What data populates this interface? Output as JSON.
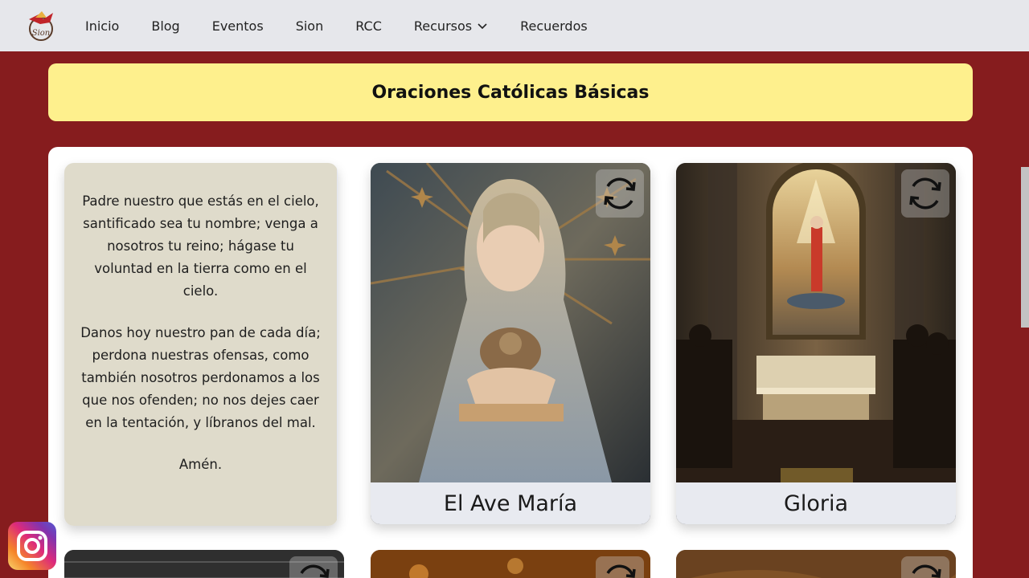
{
  "nav": {
    "items": [
      {
        "label": "Inicio"
      },
      {
        "label": "Blog"
      },
      {
        "label": "Eventos"
      },
      {
        "label": "Sion"
      },
      {
        "label": "RCC"
      },
      {
        "label": "Recursos",
        "icon": "chevron-down-icon"
      },
      {
        "label": "Recuerdos"
      }
    ],
    "logo_text": "Sion"
  },
  "banner": {
    "title": "Oraciones Católicas Básicas"
  },
  "cards": {
    "prayer": {
      "paragraph1": "Padre nuestro que estás en el cielo, santificado sea tu nombre; venga a nosotros tu reino; hágase tu voluntad en la tierra como en el cielo.",
      "paragraph2": "Danos hoy nuestro pan de cada día; perdona nuestras ofensas, como también nosotros perdonamos a los que nos ofenden; no nos dejes caer en la tentación, y líbranos del mal.",
      "paragraph3": "Amén."
    },
    "ave_maria": {
      "caption": "El Ave María"
    },
    "gloria": {
      "caption": "Gloria"
    }
  },
  "colors": {
    "page_bg": "#861c1e",
    "nav_bg": "#e6e7eb",
    "banner_bg": "#fef08d",
    "prayer_bg": "#dfdbcb"
  },
  "icons": {
    "flip": "refresh-icon",
    "social": "instagram-icon"
  }
}
